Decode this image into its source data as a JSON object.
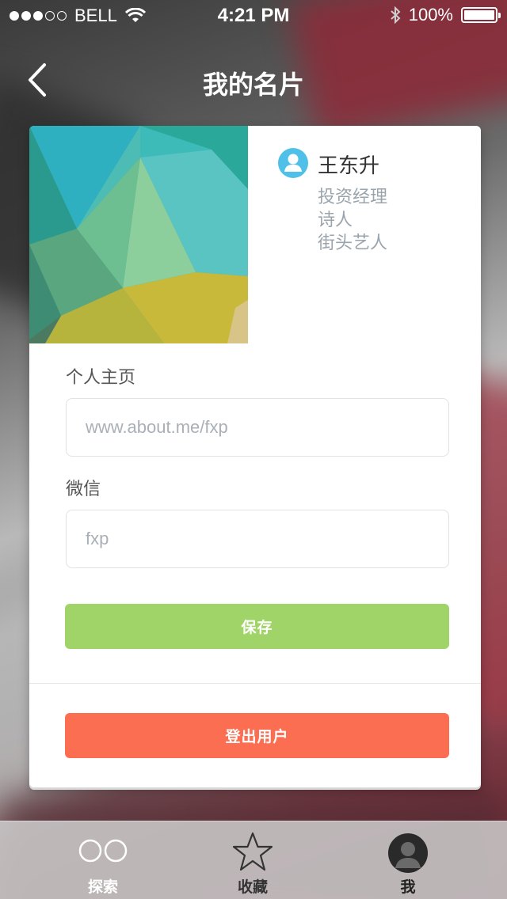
{
  "status_bar": {
    "carrier": "BELL",
    "time": "4:21 PM",
    "battery": "100%",
    "signal_bars": 3,
    "signal_total": 5
  },
  "nav": {
    "title": "我的名片",
    "back_icon": "chevron-left-icon"
  },
  "profile": {
    "name": "王东升",
    "titles": [
      "投资经理",
      "诗人",
      "街头艺人"
    ],
    "avatar_icon": "user-icon",
    "accent": "#4fc1e9"
  },
  "form": {
    "homepage_label": "个人主页",
    "homepage_placeholder": "www.about.me/fxp",
    "wechat_label": "微信",
    "wechat_placeholder": "fxp"
  },
  "buttons": {
    "save_label": "保存",
    "save_color": "#a0d468",
    "logout_label": "登出用户",
    "logout_color": "#fc6e51"
  },
  "tabs": [
    {
      "label": "探索",
      "icon": "explore-icon",
      "active": false
    },
    {
      "label": "收藏",
      "icon": "star-icon",
      "active": false
    },
    {
      "label": "我",
      "icon": "avatar-icon",
      "active": true
    }
  ]
}
